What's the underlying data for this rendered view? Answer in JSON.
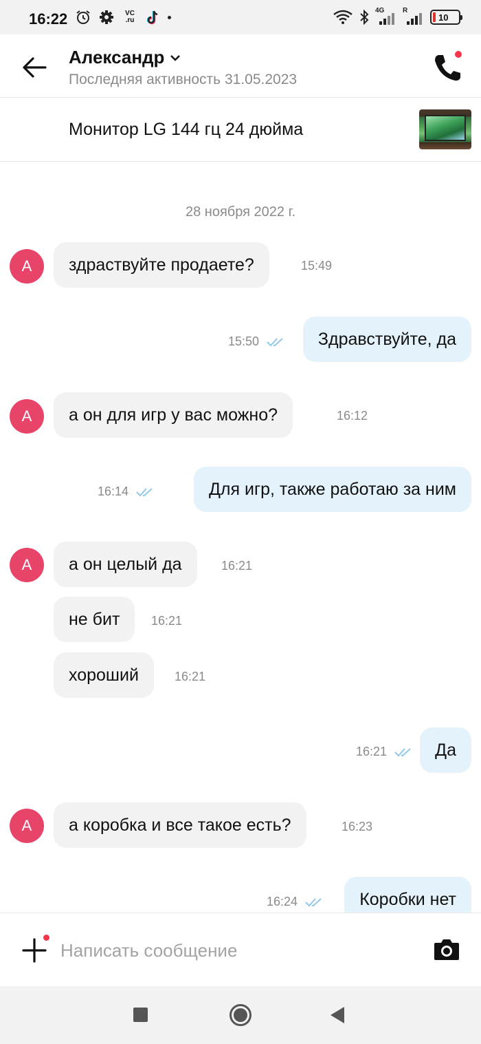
{
  "status_bar": {
    "time": "16:22",
    "vc_label": "VC\n.ru",
    "signal1_label": "4G",
    "signal2_label": "R",
    "battery": "10",
    "icons": [
      "alarm-icon",
      "gear-icon",
      "vc-ru-icon",
      "tiktok-icon",
      "dot-icon",
      "wifi-icon",
      "bluetooth-icon",
      "signal-icon",
      "battery-icon"
    ]
  },
  "header": {
    "contact_name": "Александр",
    "last_seen": "Последняя активность 31.05.2023",
    "badge_color": "#f5364a"
  },
  "listing": {
    "title": "Монитор LG 144 гц 24 дюйма"
  },
  "chat": {
    "date_separator": "28 ноября 2022 г.",
    "avatar_letter": "А",
    "avatar_color": "#e8446a",
    "incoming_bubble_color": "#f2f2f2",
    "outgoing_bubble_color": "#e4f3fb",
    "tick_color": "#8fc8ea",
    "messages": [
      {
        "direction": "in",
        "text": "здраствуйте продаете?",
        "time": "15:49",
        "avatar": true
      },
      {
        "direction": "out",
        "text": "Здравствуйте, да",
        "time": "15:50",
        "read": true
      },
      {
        "direction": "in",
        "text": "а он для игр  у вас можно?",
        "time": "16:12",
        "avatar": true
      },
      {
        "direction": "out",
        "text": "Для игр, также работаю за ним",
        "time": "16:14",
        "read": true
      },
      {
        "direction": "in",
        "text": "а он целый да",
        "time": "16:21",
        "avatar": true
      },
      {
        "direction": "in",
        "text": "не бит",
        "time": "16:21",
        "avatar": false
      },
      {
        "direction": "in",
        "text": "хороший",
        "time": "16:21",
        "avatar": false
      },
      {
        "direction": "out",
        "text": "Да",
        "time": "16:21",
        "read": true
      },
      {
        "direction": "in",
        "text": "а коробка и все такое есть?",
        "time": "16:23",
        "avatar": true
      },
      {
        "direction": "out",
        "text": "Коробки нет",
        "time": "16:24",
        "read": true
      }
    ]
  },
  "input_bar": {
    "placeholder": "Написать сообщение",
    "value": ""
  }
}
